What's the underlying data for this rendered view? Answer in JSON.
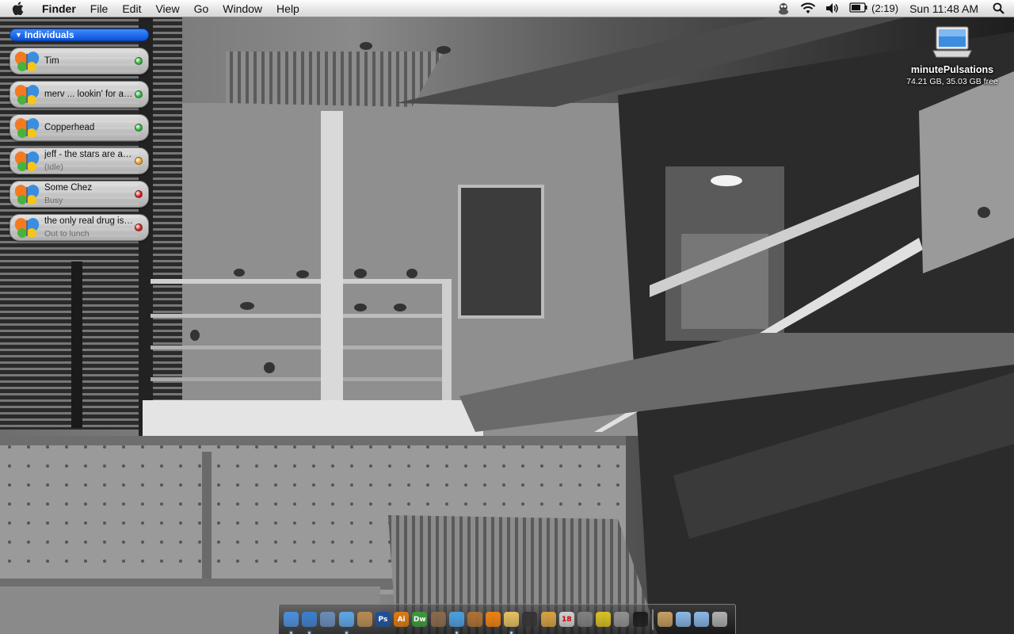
{
  "menubar": {
    "apple_icon": "apple-icon",
    "app_name": "Finder",
    "menus": [
      "File",
      "Edit",
      "View",
      "Go",
      "Window",
      "Help"
    ],
    "status_icons": [
      "adium-duck-icon",
      "wifi-icon",
      "volume-icon",
      "battery-icon",
      "spotlight-icon"
    ],
    "battery_time": "(2:19)",
    "clock": "Sun 11:48 AM"
  },
  "buddy_list": {
    "group_name": "Individuals",
    "buddies": [
      {
        "name": "Tim",
        "status": "",
        "status_color": "#2fb43a"
      },
      {
        "name": "merv ... lookin' for a new job",
        "status": "",
        "status_color": "#2fb43a"
      },
      {
        "name": "Copperhead",
        "status": "",
        "status_color": "#2fb43a"
      },
      {
        "name": "jeff - the stars are aligned",
        "status": "(Idle)",
        "status_color": "#f0a21c"
      },
      {
        "name": "Some Chez",
        "status": "Busy",
        "status_color": "#cf2020"
      },
      {
        "name": "the only real drug is love",
        "status": "Out to lunch",
        "status_color": "#cf2020"
      }
    ]
  },
  "desktop": {
    "disk_name": "minutePulsations",
    "disk_info": "74.21 GB, 35.03 GB free",
    "disk_icon": "laptop-drive-icon"
  },
  "dock": {
    "apps": [
      {
        "icon": "finder-icon",
        "label": "",
        "color": "#4a8fe0",
        "running": true
      },
      {
        "icon": "safari-icon",
        "label": "",
        "color": "#3a7fd0",
        "running": true
      },
      {
        "icon": "mail-icon",
        "label": "",
        "color": "#6a8cb8",
        "running": false
      },
      {
        "icon": "ichat-icon",
        "label": "",
        "color": "#5aa7e8",
        "running": true
      },
      {
        "icon": "address-book-icon",
        "label": "",
        "color": "#b88a52",
        "running": false
      },
      {
        "icon": "photoshop-icon",
        "label": "Ps",
        "color": "#1c4f9c",
        "running": false
      },
      {
        "icon": "illustrator-icon",
        "label": "Ai",
        "color": "#e07a10",
        "running": false
      },
      {
        "icon": "dreamweaver-icon",
        "label": "Dw",
        "color": "#3a9a3a",
        "running": false
      },
      {
        "icon": "iphoto-icon",
        "label": "",
        "color": "#8a6a4a",
        "running": false
      },
      {
        "icon": "itunes-icon",
        "label": "",
        "color": "#4aa0e0",
        "running": true
      },
      {
        "icon": "garageband-icon",
        "label": "",
        "color": "#b07030",
        "running": false
      },
      {
        "icon": "vlc-icon",
        "label": "",
        "color": "#f08010",
        "running": false
      },
      {
        "icon": "adium-icon",
        "label": "",
        "color": "#e8c060",
        "running": true
      },
      {
        "icon": "bomb-icon",
        "label": "",
        "color": "#333333",
        "running": false
      },
      {
        "icon": "notes-icon",
        "label": "",
        "color": "#d8a040",
        "running": false
      },
      {
        "icon": "ical-icon",
        "label": "18",
        "color": "#d0d0d0",
        "running": false
      },
      {
        "icon": "sync-icon",
        "label": "",
        "color": "#808080",
        "running": false
      },
      {
        "icon": "radiation-icon",
        "label": "",
        "color": "#d8c020",
        "running": false
      },
      {
        "icon": "system-preferences-icon",
        "label": "",
        "color": "#909090",
        "running": false
      },
      {
        "icon": "terminal-icon",
        "label": "",
        "color": "#1a1a1a",
        "running": false
      }
    ],
    "stacks": [
      {
        "icon": "documents-stack-icon",
        "label": "",
        "color": "#c8a060"
      },
      {
        "icon": "applications-folder-icon",
        "label": "",
        "color": "#8ab8e8"
      },
      {
        "icon": "downloads-folder-icon",
        "label": "",
        "color": "#8ab8e8"
      },
      {
        "icon": "trash-icon",
        "label": "",
        "color": "#b0b0b0"
      }
    ]
  }
}
